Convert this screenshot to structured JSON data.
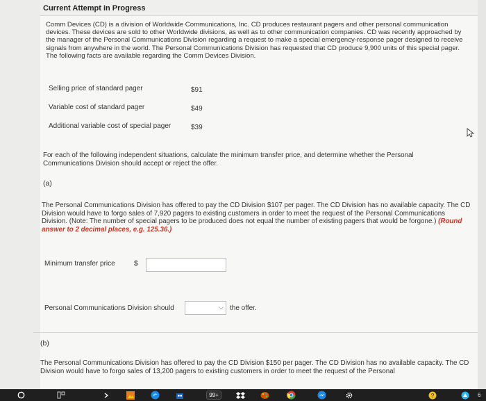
{
  "header": {
    "title": "Current Attempt in Progress"
  },
  "intro": "Comm Devices (CD) is a division of Worldwide Communications, Inc. CD produces restaurant pagers and other personal communication devices. These devices are sold to other Worldwide divisions, as well as to other communication companies. CD was recently approached by the manager of the Personal Communications Division regarding a request to make a special emergency-response pager designed to receive signals from anywhere in the world. The Personal Communications Division has requested that CD produce 9,900 units of this special pager. The following facts are available regarding the Comm Devices Division.",
  "facts": [
    {
      "label": "Selling price of standard pager",
      "value": "$91"
    },
    {
      "label": "Variable cost of standard pager",
      "value": "$49"
    },
    {
      "label": "Additional variable cost of special pager",
      "value": "$39"
    }
  ],
  "instructions": "For each of the following independent situations, calculate the minimum transfer price, and determine whether the Personal Communications Division should accept or reject the offer.",
  "part_a": {
    "label": "(a)",
    "text": "The Personal Communications Division has offered to pay the CD Division $107 per pager. The CD Division has no available capacity. The CD Division would have to forgo sales of 7,920 pagers to existing customers in order to meet the request of the Personal Communications Division. (Note: The number of special pagers to be produced does not equal the number of existing pagers that would be forgone.) ",
    "emphasis": "(Round answer to 2 decimal places, e.g. 125.36.)",
    "min_price_label": "Minimum transfer price",
    "currency": "$",
    "min_price_value": "",
    "should_label": "Personal Communications Division should",
    "should_selected": "",
    "should_suffix": "the offer."
  },
  "part_b": {
    "label": "(b)",
    "text": "The Personal Communications Division has offered to pay the CD Division $150 per pager. The CD Division has no available capacity. The CD Division would have to forgo sales of 13,200 pagers to existing customers in order to meet the request of the Personal"
  },
  "taskbar": {
    "badge": "99+",
    "right_text": "6"
  },
  "colors": {
    "page_bg": "#f7f7f5",
    "emphasis": "#c0392b",
    "taskbar_bg": "#1f1f1f"
  }
}
